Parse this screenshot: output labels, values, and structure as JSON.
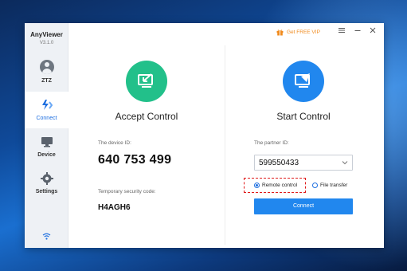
{
  "app": {
    "name": "AnyViewer",
    "version": "V3.1.0"
  },
  "user": {
    "name": "ZTZ"
  },
  "sidebar": {
    "items": [
      {
        "label": "Connect",
        "icon": "connect-icon",
        "active": true
      },
      {
        "label": "Device",
        "icon": "monitor-icon",
        "active": false
      },
      {
        "label": "Settings",
        "icon": "gear-icon",
        "active": false
      }
    ]
  },
  "titlebar": {
    "vip_label": "Get FREE VIP"
  },
  "accept": {
    "title": "Accept Control",
    "device_id_label": "The device ID:",
    "device_id": "640 753 499",
    "security_label": "Temporary security code:",
    "security_code": "H4AGH6"
  },
  "start": {
    "title": "Start Control",
    "partner_label": "The partner ID:",
    "partner_id": "599550433",
    "options": [
      {
        "label": "Remote control",
        "selected": true
      },
      {
        "label": "File transfer",
        "selected": false
      }
    ],
    "connect_label": "Connect"
  },
  "colors": {
    "accent_blue": "#2187ee",
    "accept_green": "#22c08a",
    "vip_orange": "#f08a1c",
    "highlight_red": "#e01b1b"
  }
}
